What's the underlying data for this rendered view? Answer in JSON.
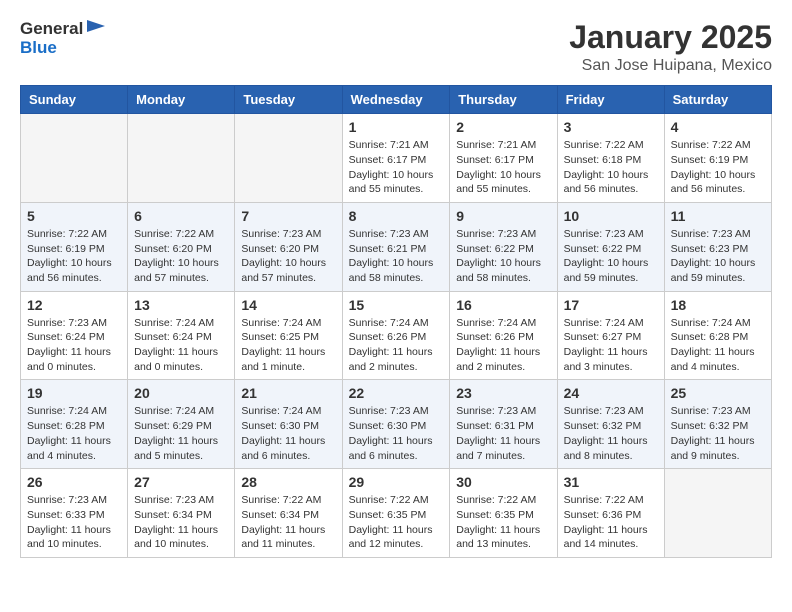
{
  "header": {
    "logo_general": "General",
    "logo_blue": "Blue",
    "month_title": "January 2025",
    "location": "San Jose Huipana, Mexico"
  },
  "weekdays": [
    "Sunday",
    "Monday",
    "Tuesday",
    "Wednesday",
    "Thursday",
    "Friday",
    "Saturday"
  ],
  "weeks": [
    [
      {
        "day": "",
        "info": ""
      },
      {
        "day": "",
        "info": ""
      },
      {
        "day": "",
        "info": ""
      },
      {
        "day": "1",
        "info": "Sunrise: 7:21 AM\nSunset: 6:17 PM\nDaylight: 10 hours\nand 55 minutes."
      },
      {
        "day": "2",
        "info": "Sunrise: 7:21 AM\nSunset: 6:17 PM\nDaylight: 10 hours\nand 55 minutes."
      },
      {
        "day": "3",
        "info": "Sunrise: 7:22 AM\nSunset: 6:18 PM\nDaylight: 10 hours\nand 56 minutes."
      },
      {
        "day": "4",
        "info": "Sunrise: 7:22 AM\nSunset: 6:19 PM\nDaylight: 10 hours\nand 56 minutes."
      }
    ],
    [
      {
        "day": "5",
        "info": "Sunrise: 7:22 AM\nSunset: 6:19 PM\nDaylight: 10 hours\nand 56 minutes."
      },
      {
        "day": "6",
        "info": "Sunrise: 7:22 AM\nSunset: 6:20 PM\nDaylight: 10 hours\nand 57 minutes."
      },
      {
        "day": "7",
        "info": "Sunrise: 7:23 AM\nSunset: 6:20 PM\nDaylight: 10 hours\nand 57 minutes."
      },
      {
        "day": "8",
        "info": "Sunrise: 7:23 AM\nSunset: 6:21 PM\nDaylight: 10 hours\nand 58 minutes."
      },
      {
        "day": "9",
        "info": "Sunrise: 7:23 AM\nSunset: 6:22 PM\nDaylight: 10 hours\nand 58 minutes."
      },
      {
        "day": "10",
        "info": "Sunrise: 7:23 AM\nSunset: 6:22 PM\nDaylight: 10 hours\nand 59 minutes."
      },
      {
        "day": "11",
        "info": "Sunrise: 7:23 AM\nSunset: 6:23 PM\nDaylight: 10 hours\nand 59 minutes."
      }
    ],
    [
      {
        "day": "12",
        "info": "Sunrise: 7:23 AM\nSunset: 6:24 PM\nDaylight: 11 hours\nand 0 minutes."
      },
      {
        "day": "13",
        "info": "Sunrise: 7:24 AM\nSunset: 6:24 PM\nDaylight: 11 hours\nand 0 minutes."
      },
      {
        "day": "14",
        "info": "Sunrise: 7:24 AM\nSunset: 6:25 PM\nDaylight: 11 hours\nand 1 minute."
      },
      {
        "day": "15",
        "info": "Sunrise: 7:24 AM\nSunset: 6:26 PM\nDaylight: 11 hours\nand 2 minutes."
      },
      {
        "day": "16",
        "info": "Sunrise: 7:24 AM\nSunset: 6:26 PM\nDaylight: 11 hours\nand 2 minutes."
      },
      {
        "day": "17",
        "info": "Sunrise: 7:24 AM\nSunset: 6:27 PM\nDaylight: 11 hours\nand 3 minutes."
      },
      {
        "day": "18",
        "info": "Sunrise: 7:24 AM\nSunset: 6:28 PM\nDaylight: 11 hours\nand 4 minutes."
      }
    ],
    [
      {
        "day": "19",
        "info": "Sunrise: 7:24 AM\nSunset: 6:28 PM\nDaylight: 11 hours\nand 4 minutes."
      },
      {
        "day": "20",
        "info": "Sunrise: 7:24 AM\nSunset: 6:29 PM\nDaylight: 11 hours\nand 5 minutes."
      },
      {
        "day": "21",
        "info": "Sunrise: 7:24 AM\nSunset: 6:30 PM\nDaylight: 11 hours\nand 6 minutes."
      },
      {
        "day": "22",
        "info": "Sunrise: 7:23 AM\nSunset: 6:30 PM\nDaylight: 11 hours\nand 6 minutes."
      },
      {
        "day": "23",
        "info": "Sunrise: 7:23 AM\nSunset: 6:31 PM\nDaylight: 11 hours\nand 7 minutes."
      },
      {
        "day": "24",
        "info": "Sunrise: 7:23 AM\nSunset: 6:32 PM\nDaylight: 11 hours\nand 8 minutes."
      },
      {
        "day": "25",
        "info": "Sunrise: 7:23 AM\nSunset: 6:32 PM\nDaylight: 11 hours\nand 9 minutes."
      }
    ],
    [
      {
        "day": "26",
        "info": "Sunrise: 7:23 AM\nSunset: 6:33 PM\nDaylight: 11 hours\nand 10 minutes."
      },
      {
        "day": "27",
        "info": "Sunrise: 7:23 AM\nSunset: 6:34 PM\nDaylight: 11 hours\nand 10 minutes."
      },
      {
        "day": "28",
        "info": "Sunrise: 7:22 AM\nSunset: 6:34 PM\nDaylight: 11 hours\nand 11 minutes."
      },
      {
        "day": "29",
        "info": "Sunrise: 7:22 AM\nSunset: 6:35 PM\nDaylight: 11 hours\nand 12 minutes."
      },
      {
        "day": "30",
        "info": "Sunrise: 7:22 AM\nSunset: 6:35 PM\nDaylight: 11 hours\nand 13 minutes."
      },
      {
        "day": "31",
        "info": "Sunrise: 7:22 AM\nSunset: 6:36 PM\nDaylight: 11 hours\nand 14 minutes."
      },
      {
        "day": "",
        "info": ""
      }
    ]
  ]
}
